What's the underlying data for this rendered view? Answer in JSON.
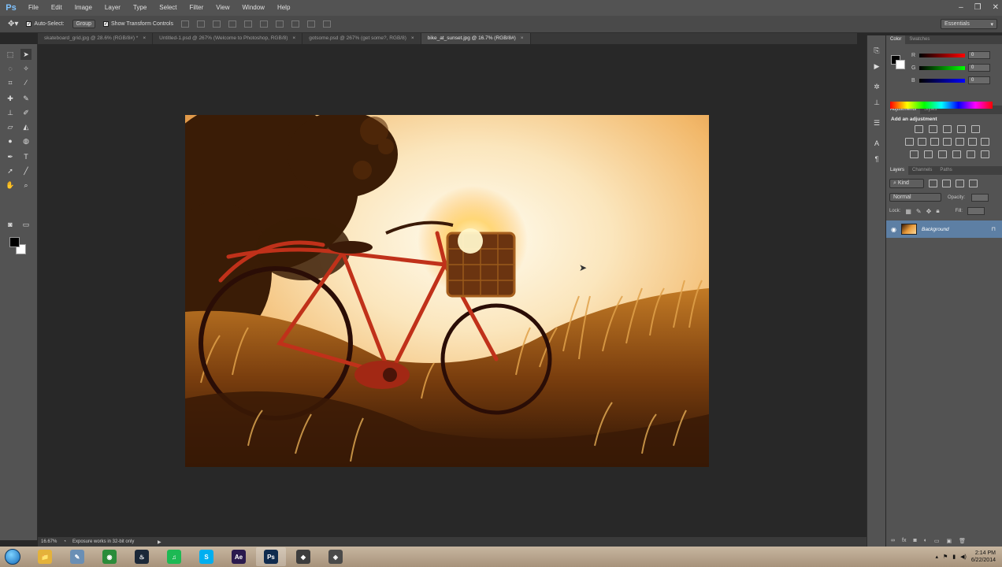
{
  "app": {
    "logo": "Ps"
  },
  "menubar": {
    "items": [
      "File",
      "Edit",
      "Image",
      "Layer",
      "Type",
      "Select",
      "Filter",
      "View",
      "Window",
      "Help"
    ],
    "window_controls": [
      "–",
      "❐",
      "✕"
    ]
  },
  "options": {
    "auto_select_label": "Auto-Select:",
    "auto_select_value": "Group",
    "show_transform_label": "Show Transform Controls",
    "workspace": "Essentials"
  },
  "tabs": [
    {
      "label": "skateboard_grid.jpg @ 28.6% (RGB/8#) *",
      "close": "×"
    },
    {
      "label": "Untitled-1.psd @ 267% (Welcome to Photoshop, RGB/8)",
      "close": "×"
    },
    {
      "label": "gotsome.psd @ 267% (get some?, RGB/8)",
      "close": "×"
    },
    {
      "label": "bike_at_sunset.jpg @ 16.7% (RGB/8#)",
      "close": "×"
    }
  ],
  "status": {
    "zoom": "16.67%",
    "message": "Exposure works in 32-bit only",
    "arrow": "▶"
  },
  "color_panel": {
    "tabs": [
      "Color",
      "Swatches"
    ],
    "channels": [
      {
        "label": "R",
        "value": "0",
        "gradient": "#ff0000"
      },
      {
        "label": "G",
        "value": "0",
        "gradient": "#00ff00"
      },
      {
        "label": "B",
        "value": "0",
        "gradient": "#0000ff"
      }
    ]
  },
  "adjustments_panel": {
    "tabs": [
      "Adjustments",
      "Styles"
    ],
    "heading": "Add an adjustment"
  },
  "layers_panel": {
    "tabs": [
      "Layers",
      "Channels",
      "Paths"
    ],
    "kind_label": "Kind",
    "blend_mode": "Normal",
    "opacity_label": "Opacity:",
    "lock_label": "Lock:",
    "fill_label": "Fill:",
    "layer_name": "Background"
  },
  "taskbar": {
    "apps": [
      {
        "name": "explorer",
        "label": "📁",
        "color": "#e4b23a"
      },
      {
        "name": "notepad",
        "label": "✎",
        "color": "#6a8fb5"
      },
      {
        "name": "chrome",
        "label": "◉",
        "color": "#2b8c3a"
      },
      {
        "name": "steam",
        "label": "♨",
        "color": "#1b2838"
      },
      {
        "name": "spotify",
        "label": "♫",
        "color": "#1db954"
      },
      {
        "name": "skype",
        "label": "S",
        "color": "#00aff0"
      },
      {
        "name": "after-effects",
        "label": "Ae",
        "color": "#2a1a4e"
      },
      {
        "name": "photoshop",
        "label": "Ps",
        "color": "#0f2b4e"
      },
      {
        "name": "tool-a",
        "label": "◆",
        "color": "#3d3d3d"
      },
      {
        "name": "tool-b",
        "label": "◈",
        "color": "#4a4a4a"
      }
    ],
    "time": "2:14 PM",
    "date": "6/22/2014"
  }
}
